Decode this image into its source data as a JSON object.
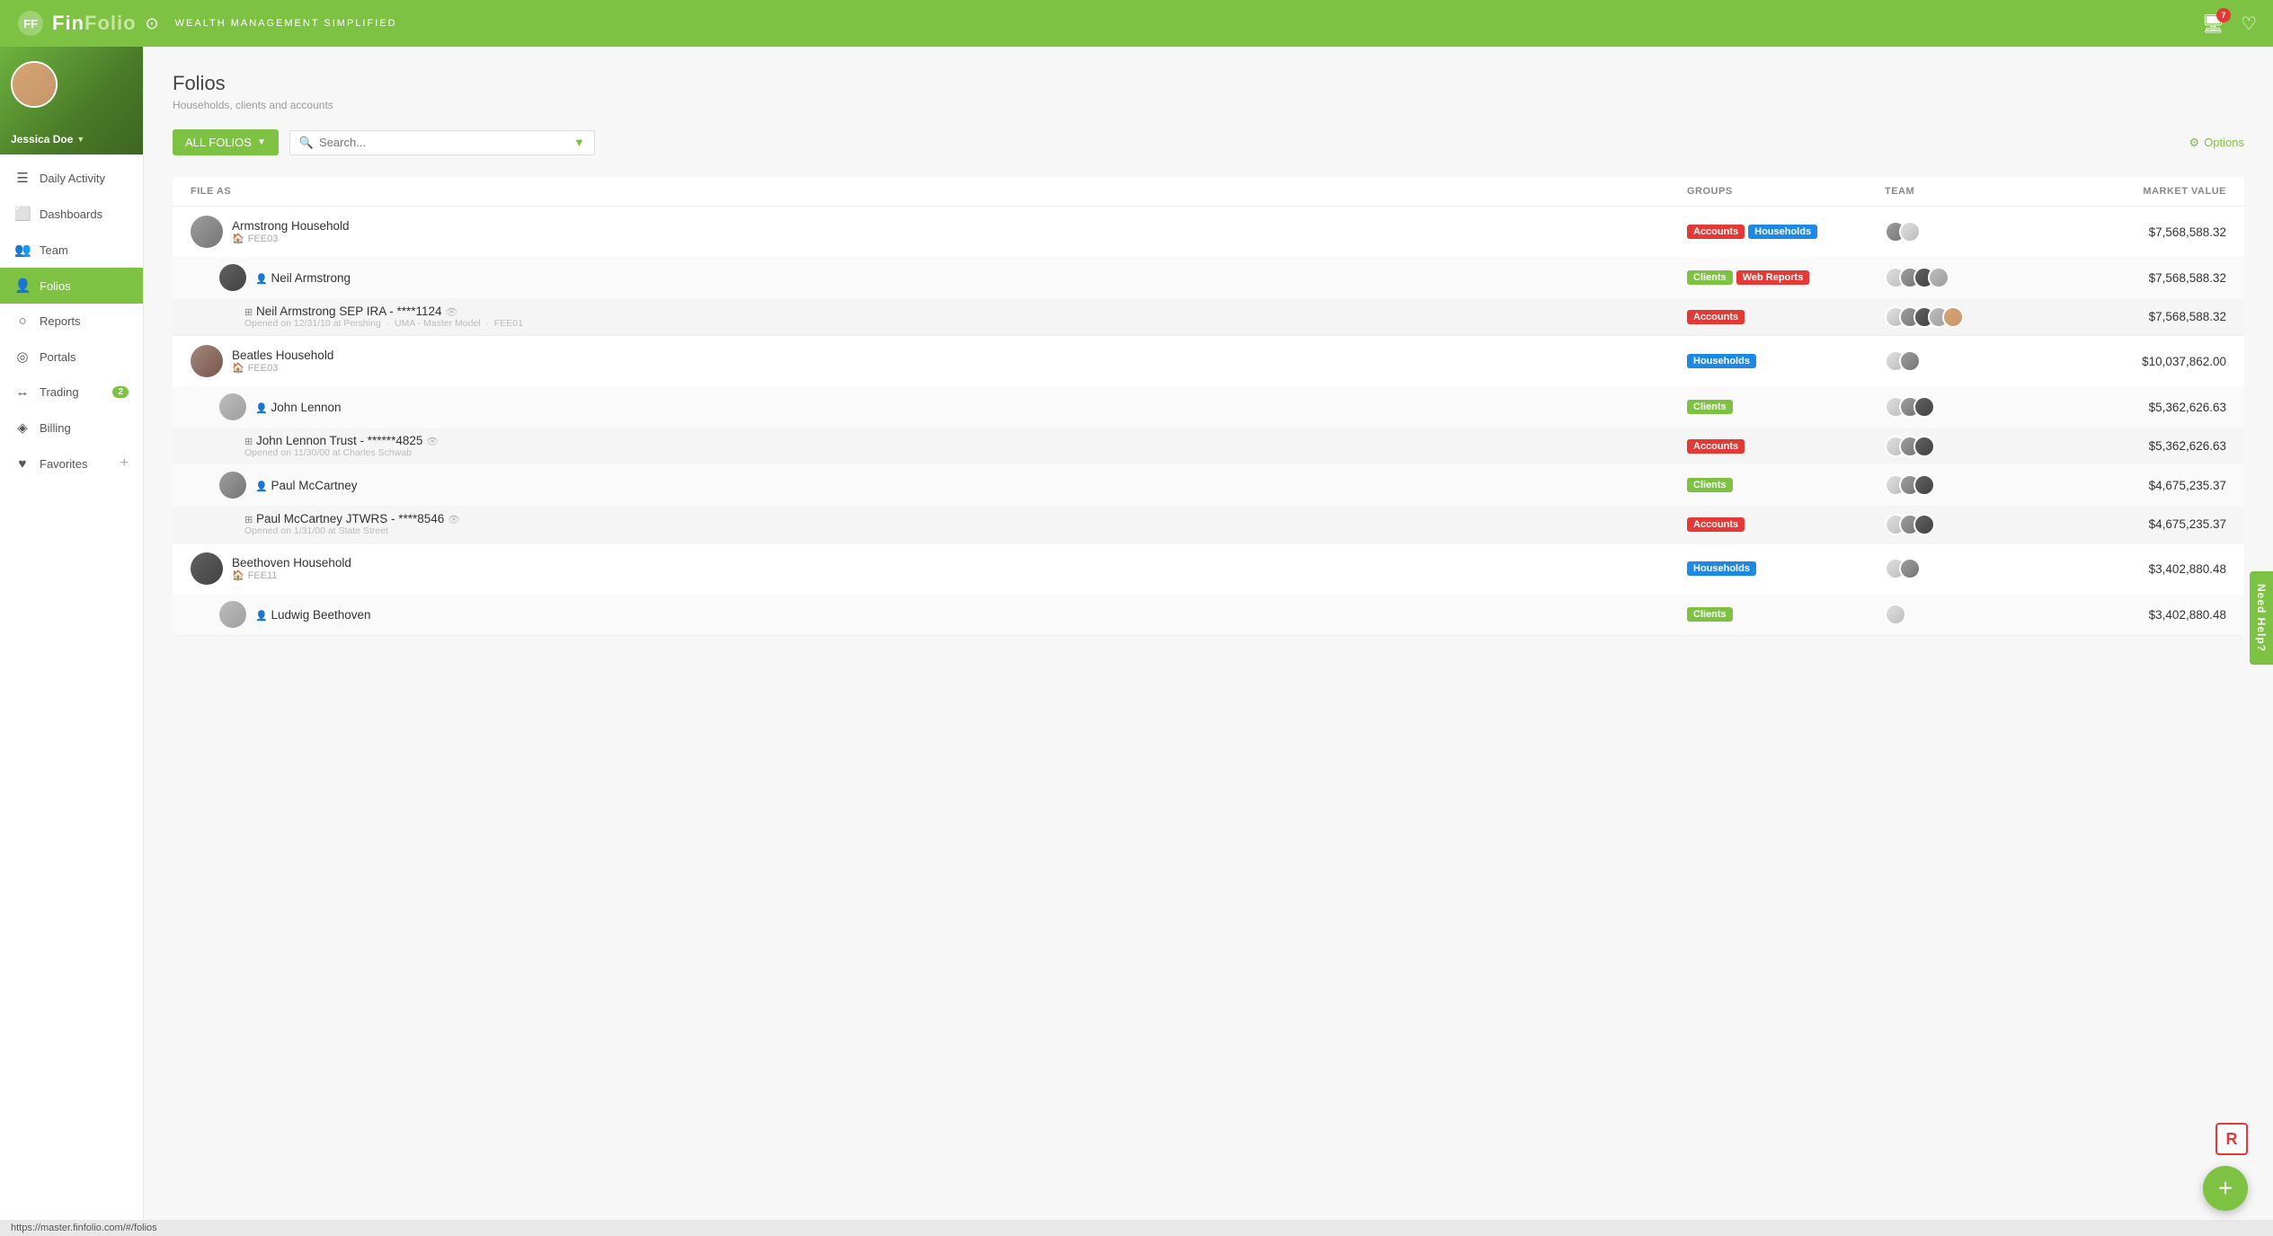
{
  "app": {
    "logo": "FinFolio",
    "logo_highlight": "G",
    "subtitle": "WEALTH MANAGEMENT SIMPLIFIED",
    "badge_count": "7"
  },
  "sidebar": {
    "username": "Jessica Doe",
    "nav_items": [
      {
        "id": "daily-activity",
        "label": "Daily Activity",
        "icon": "☰",
        "active": false
      },
      {
        "id": "dashboards",
        "label": "Dashboards",
        "icon": "⬜",
        "active": false
      },
      {
        "id": "team",
        "label": "Team",
        "icon": "👥",
        "active": false
      },
      {
        "id": "folios",
        "label": "Folios",
        "icon": "👤",
        "active": true
      },
      {
        "id": "reports",
        "label": "Reports",
        "icon": "○",
        "active": false
      },
      {
        "id": "portals",
        "label": "Portals",
        "icon": "◎",
        "active": false
      },
      {
        "id": "trading",
        "label": "Trading",
        "icon": "↔",
        "active": false,
        "badge": "2"
      },
      {
        "id": "billing",
        "label": "Billing",
        "icon": "◈",
        "active": false
      },
      {
        "id": "favorites",
        "label": "Favorites",
        "icon": "♥",
        "active": false,
        "add": true
      }
    ]
  },
  "page": {
    "title": "Folios",
    "subtitle": "Households, clients and accounts"
  },
  "toolbar": {
    "all_folios_btn": "ALL FOLIOS",
    "search_placeholder": "Search...",
    "options_label": "Options"
  },
  "table": {
    "headers": {
      "file_as": "FILE AS",
      "groups": "GROUPS",
      "team": "TEAM",
      "market_value": "MARKET VALUE"
    },
    "rows": [
      {
        "type": "household",
        "name": "Armstrong Household",
        "id": "FEE03",
        "groups": [
          "Accounts",
          "Households"
        ],
        "market_value": "$7,568,588.32",
        "team_count": 2,
        "children": [
          {
            "type": "client",
            "name": "Neil Armstrong",
            "groups": [
              "Clients",
              "Web Reports"
            ],
            "market_value": "$7,568,588.32",
            "team_count": 4,
            "accounts": [
              {
                "type": "account",
                "name": "Neil Armstrong SEP IRA",
                "number": "****1124",
                "opened": "Opened on 12/31/10 at Pershing",
                "detail1": "UMA - Master Model",
                "detail2": "FEE01",
                "groups": [
                  "Accounts"
                ],
                "market_value": "$7,568,588.32",
                "team_count": 5
              }
            ]
          }
        ]
      },
      {
        "type": "household",
        "name": "Beatles Household",
        "id": "FEE03",
        "groups": [
          "Households"
        ],
        "market_value": "$10,037,862.00",
        "team_count": 2,
        "children": [
          {
            "type": "client",
            "name": "John Lennon",
            "groups": [
              "Clients"
            ],
            "market_value": "$5,362,626.63",
            "team_count": 3,
            "accounts": [
              {
                "type": "account",
                "name": "John Lennon Trust",
                "number": "******4825",
                "opened": "Opened on 11/30/00 at Charles Schwab",
                "detail1": "",
                "detail2": "",
                "groups": [
                  "Accounts"
                ],
                "market_value": "$5,362,626.63",
                "team_count": 3
              }
            ]
          },
          {
            "type": "client",
            "name": "Paul McCartney",
            "groups": [
              "Clients"
            ],
            "market_value": "$4,675,235.37",
            "team_count": 3,
            "accounts": [
              {
                "type": "account",
                "name": "Paul McCartney JTWRS",
                "number": "****8546",
                "opened": "Opened on 1/31/00 at State Street",
                "detail1": "",
                "detail2": "",
                "groups": [
                  "Accounts"
                ],
                "market_value": "$4,675,235.37",
                "team_count": 3
              }
            ]
          }
        ]
      },
      {
        "type": "household",
        "name": "Beethoven Household",
        "id": "FEE11",
        "groups": [
          "Households"
        ],
        "market_value": "$3,402,880.48",
        "team_count": 2,
        "children": [
          {
            "type": "client",
            "name": "Ludwig Beethoven",
            "groups": [
              "Clients"
            ],
            "market_value": "$3,402,880.48",
            "team_count": 1
          }
        ]
      }
    ]
  },
  "help_tab": "Need Help?",
  "status_bar": "https://master.finfolio.com/#/folios",
  "fab": "+",
  "r_btn": "R"
}
